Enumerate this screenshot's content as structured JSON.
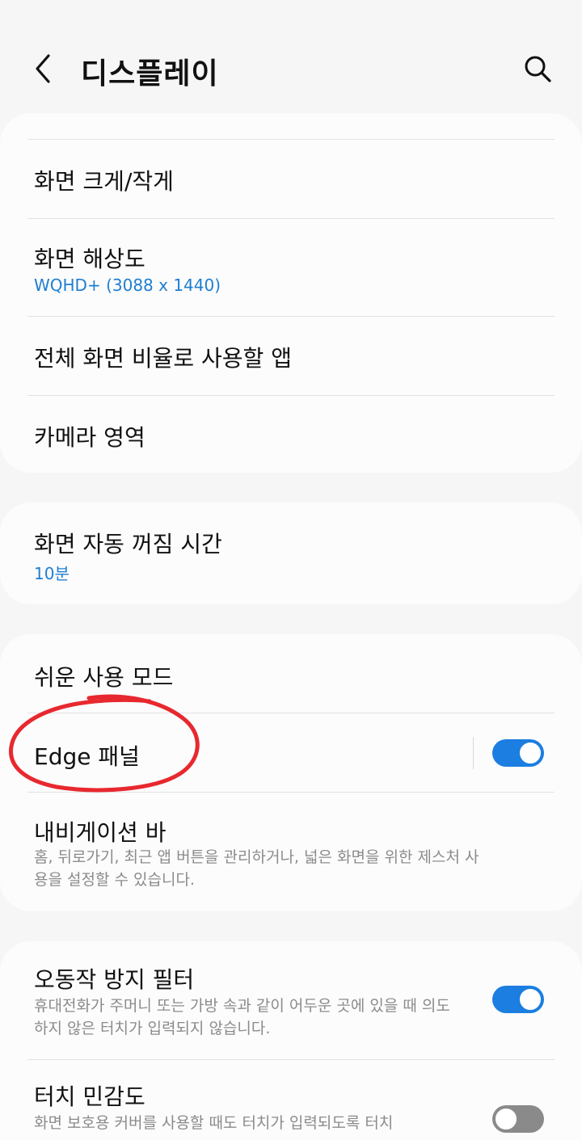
{
  "header": {
    "title": "디스플레이",
    "back_icon": "chevron-left-icon",
    "search_icon": "search-icon"
  },
  "group1": {
    "screen_zoom": {
      "title": "화면 크게/작게"
    },
    "screen_resolution": {
      "title": "화면 해상도",
      "value": "WQHD+ (3088 x 1440)"
    },
    "fullscreen_apps": {
      "title": "전체 화면 비율로 사용할 앱"
    },
    "camera_cutout": {
      "title": "카메라 영역"
    }
  },
  "group2": {
    "screen_timeout": {
      "title": "화면 자동 꺼짐 시간",
      "value": "10분"
    }
  },
  "group3": {
    "easy_mode": {
      "title": "쉬운 사용 모드"
    },
    "edge_panels": {
      "title": "Edge 패널",
      "enabled": true
    },
    "navigation_bar": {
      "title": "내비게이션 바",
      "description": "홈, 뒤로가기, 최근 앱 버튼을 관리하거나, 넓은 화면을 위한 제스처 사용을 설정할 수 있습니다."
    }
  },
  "group4": {
    "accidental_touch": {
      "title": "오동작 방지 필터",
      "description": "휴대전화가 주머니 또는 가방 속과 같이 어두운 곳에 있을 때 의도하지 않은 터치가 입력되지 않습니다.",
      "enabled": true
    },
    "touch_sensitivity": {
      "title": "터치 민감도",
      "description": "화면 보호용 커버를 사용할 때도 터치가 입력되도록 터치",
      "enabled": false
    }
  },
  "colors": {
    "accent": "#1b7ee0",
    "link_blue": "#1f7ed3",
    "annotation_red": "#e8282f",
    "background": "#f6f6f6",
    "card": "#fcfcfc"
  }
}
